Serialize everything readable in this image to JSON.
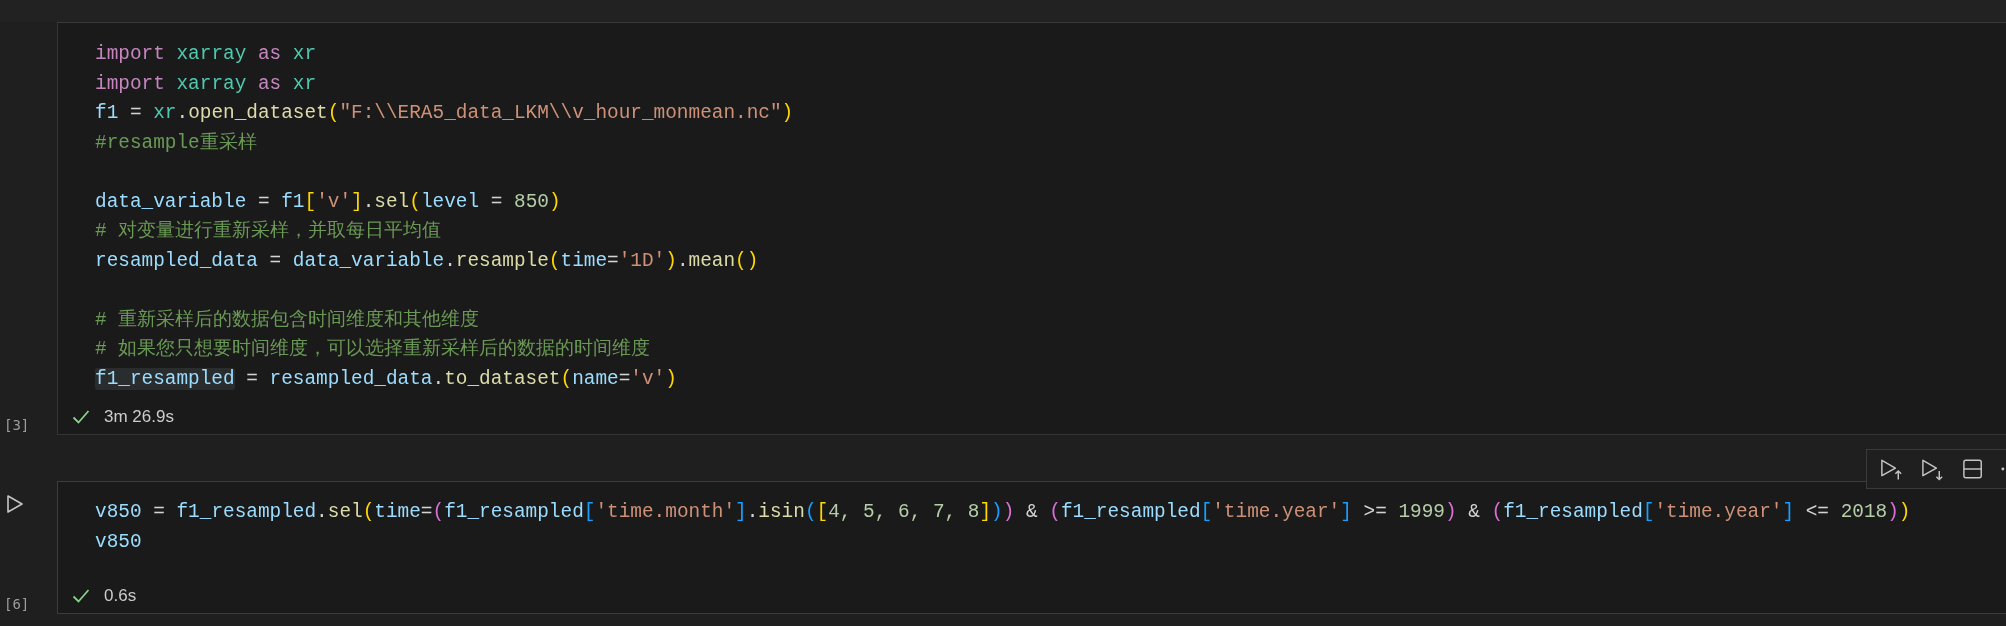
{
  "cells": [
    {
      "execution_count": "[3]",
      "hovered": false,
      "status": {
        "success": true,
        "time": "3m 26.9s"
      },
      "lines": [
        {
          "tokens": [
            {
              "text": "import ",
              "kind": "keyword"
            },
            {
              "text": "xarray ",
              "kind": "module"
            },
            {
              "text": "as ",
              "kind": "keyword"
            },
            {
              "text": "xr",
              "kind": "module"
            }
          ]
        },
        {
          "tokens": [
            {
              "text": "import ",
              "kind": "keyword"
            },
            {
              "text": "xarray ",
              "kind": "module"
            },
            {
              "text": "as ",
              "kind": "keyword"
            },
            {
              "text": "xr",
              "kind": "module"
            }
          ]
        },
        {
          "tokens": [
            {
              "text": "f1",
              "kind": "variable"
            },
            {
              "text": " = ",
              "kind": "plain"
            },
            {
              "text": "xr",
              "kind": "module"
            },
            {
              "text": ".",
              "kind": "plain"
            },
            {
              "text": "open_dataset",
              "kind": "function"
            },
            {
              "text": "(",
              "kind": "bracket1"
            },
            {
              "text": "\"F:\\\\ERA5_data_LKM\\\\v_hour_monmean.nc\"",
              "kind": "string"
            },
            {
              "text": ")",
              "kind": "bracket1"
            }
          ]
        },
        {
          "tokens": [
            {
              "text": "#resample重采样",
              "kind": "comment"
            }
          ]
        },
        {
          "space_before": true,
          "tokens": [
            {
              "text": "data_variable",
              "kind": "variable"
            },
            {
              "text": " = ",
              "kind": "plain"
            },
            {
              "text": "f1",
              "kind": "variable"
            },
            {
              "text": "[",
              "kind": "bracket1"
            },
            {
              "text": "'v'",
              "kind": "string"
            },
            {
              "text": "]",
              "kind": "bracket1"
            },
            {
              "text": ".",
              "kind": "plain"
            },
            {
              "text": "sel",
              "kind": "function"
            },
            {
              "text": "(",
              "kind": "bracket1"
            },
            {
              "text": "level",
              "kind": "variable"
            },
            {
              "text": " = ",
              "kind": "plain"
            },
            {
              "text": "850",
              "kind": "number"
            },
            {
              "text": ")",
              "kind": "bracket1"
            }
          ]
        },
        {
          "tokens": [
            {
              "text": "# 对变量进行重新采样，并取每日平均值",
              "kind": "comment"
            }
          ]
        },
        {
          "tokens": [
            {
              "text": "resampled_data",
              "kind": "variable"
            },
            {
              "text": " = ",
              "kind": "plain"
            },
            {
              "text": "data_variable",
              "kind": "variable"
            },
            {
              "text": ".",
              "kind": "plain"
            },
            {
              "text": "resample",
              "kind": "function"
            },
            {
              "text": "(",
              "kind": "bracket1"
            },
            {
              "text": "time",
              "kind": "variable"
            },
            {
              "text": "=",
              "kind": "plain"
            },
            {
              "text": "'1D'",
              "kind": "string"
            },
            {
              "text": ")",
              "kind": "bracket1"
            },
            {
              "text": ".",
              "kind": "plain"
            },
            {
              "text": "mean",
              "kind": "function"
            },
            {
              "text": "()",
              "kind": "bracket1"
            }
          ]
        },
        {
          "space_before": true,
          "tokens": [
            {
              "text": "# 重新采样后的数据包含时间维度和其他维度",
              "kind": "comment"
            }
          ]
        },
        {
          "tokens": [
            {
              "text": "# 如果您只想要时间维度，可以选择重新采样后的数据的时间维度",
              "kind": "comment"
            }
          ]
        },
        {
          "tokens": [
            {
              "text": "f1_resampled",
              "kind": "variable",
              "highlighted": true
            },
            {
              "text": " = ",
              "kind": "plain"
            },
            {
              "text": "resampled_data",
              "kind": "variable"
            },
            {
              "text": ".",
              "kind": "plain"
            },
            {
              "text": "to_dataset",
              "kind": "function"
            },
            {
              "text": "(",
              "kind": "bracket1"
            },
            {
              "text": "name",
              "kind": "variable"
            },
            {
              "text": "=",
              "kind": "plain"
            },
            {
              "text": "'v'",
              "kind": "string"
            },
            {
              "text": ")",
              "kind": "bracket1"
            }
          ]
        }
      ]
    },
    {
      "execution_count": "[6]",
      "hovered": true,
      "status": {
        "success": true,
        "time": "0.6s"
      },
      "lines": [
        {
          "tokens": [
            {
              "text": "v850",
              "kind": "variable"
            },
            {
              "text": " = ",
              "kind": "plain"
            },
            {
              "text": "f1_resampled",
              "kind": "variable"
            },
            {
              "text": ".",
              "kind": "plain"
            },
            {
              "text": "sel",
              "kind": "function"
            },
            {
              "text": "(",
              "kind": "bracket1"
            },
            {
              "text": "time",
              "kind": "variable"
            },
            {
              "text": "=",
              "kind": "plain"
            },
            {
              "text": "(",
              "kind": "bracket2"
            },
            {
              "text": "f1_resampled",
              "kind": "variable"
            },
            {
              "text": "[",
              "kind": "bracket3"
            },
            {
              "text": "'time.month'",
              "kind": "string"
            },
            {
              "text": "]",
              "kind": "bracket3"
            },
            {
              "text": ".",
              "kind": "plain"
            },
            {
              "text": "isin",
              "kind": "function"
            },
            {
              "text": "(",
              "kind": "bracket3"
            },
            {
              "text": "[",
              "kind": "bracket1"
            },
            {
              "text": "4, 5, 6, 7, 8",
              "kind": "number"
            },
            {
              "text": "]",
              "kind": "bracket1"
            },
            {
              "text": ")",
              "kind": "bracket3"
            },
            {
              "text": ")",
              "kind": "bracket2"
            },
            {
              "text": " & ",
              "kind": "plain"
            },
            {
              "text": "(",
              "kind": "bracket2"
            },
            {
              "text": "f1_resampled",
              "kind": "variable"
            },
            {
              "text": "[",
              "kind": "bracket3"
            },
            {
              "text": "'time.year'",
              "kind": "string"
            },
            {
              "text": "]",
              "kind": "bracket3"
            },
            {
              "text": " >= ",
              "kind": "plain"
            },
            {
              "text": "1999",
              "kind": "number"
            },
            {
              "text": ")",
              "kind": "bracket2"
            },
            {
              "text": " & ",
              "kind": "plain"
            },
            {
              "text": "(",
              "kind": "bracket2"
            },
            {
              "text": "f1_resampled",
              "kind": "variable"
            },
            {
              "text": "[",
              "kind": "bracket3"
            },
            {
              "text": "'time.year'",
              "kind": "string"
            },
            {
              "text": "]",
              "kind": "bracket3"
            },
            {
              "text": " <= ",
              "kind": "plain"
            },
            {
              "text": "2018",
              "kind": "number"
            },
            {
              "text": ")",
              "kind": "bracket2"
            },
            {
              "text": ")",
              "kind": "bracket1"
            }
          ]
        },
        {
          "tokens": [
            {
              "text": "v850",
              "kind": "variable"
            }
          ]
        }
      ]
    }
  ]
}
